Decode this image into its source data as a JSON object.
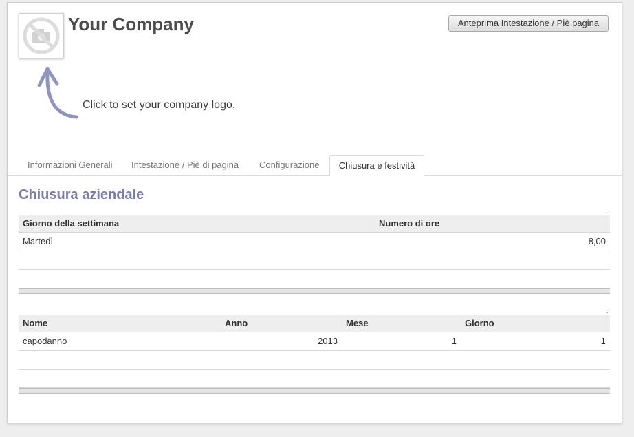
{
  "header": {
    "company_name": "Your Company",
    "preview_button": "Anteprima Intestazione / Piè pagina",
    "logo_hint": "Click to set your company logo.",
    "logo_icon": "no-camera-icon"
  },
  "tabs": [
    {
      "label": "Informazioni Generali",
      "active": false
    },
    {
      "label": "Intestazione / Piè di pagina",
      "active": false
    },
    {
      "label": "Configurazione",
      "active": false
    },
    {
      "label": "Chiusura e festività",
      "active": true
    }
  ],
  "section": {
    "title": "Chiusura aziendale"
  },
  "weekly_closure": {
    "columns": [
      "Giorno della settimana",
      "Numero di ore"
    ],
    "rows": [
      {
        "day": "Martedì",
        "hours": "8,00"
      }
    ]
  },
  "holidays": {
    "columns": [
      "Nome",
      "Anno",
      "Mese",
      "Giorno"
    ],
    "rows": [
      {
        "name": "capodanno",
        "year": "2013",
        "month": "1",
        "day": "1"
      }
    ]
  },
  "colors": {
    "section_title": "#7c7bad",
    "arrow": "#8f95c0",
    "header_bg": "#eeeeee"
  }
}
